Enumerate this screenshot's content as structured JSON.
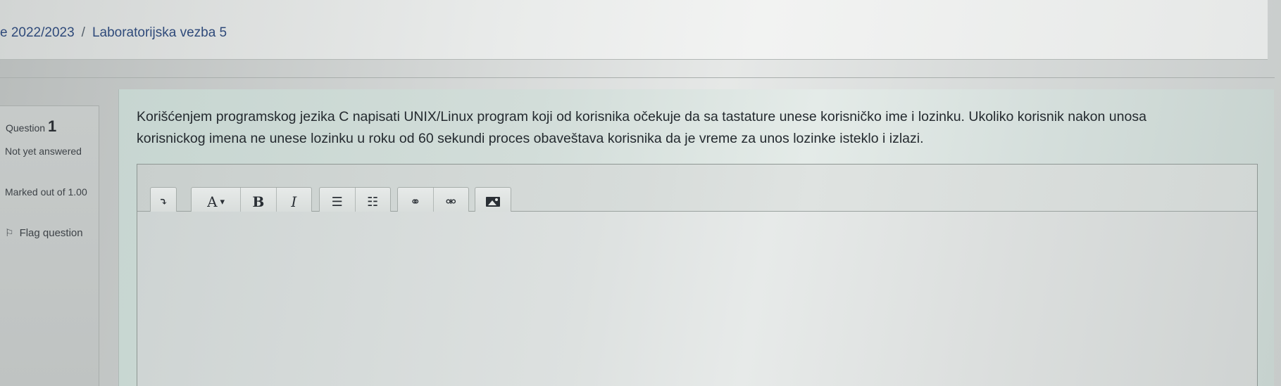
{
  "breadcrumb": {
    "items": [
      "e 2022/2023",
      "Laboratorijska vezba 5"
    ],
    "separator": "/"
  },
  "question_info": {
    "label": "Question",
    "number": "1",
    "state": "Not yet answered",
    "grade": "Marked out of 1.00",
    "flag_label": "Flag question"
  },
  "question": {
    "text": "Korišćenjem programskog jezika C napisati UNIX/Linux program koji od korisnika očekuje da sa tastature unese korisničko ime i lozinku. Ukoliko korisnik nakon unosa korisnickog imena ne unese lozinku u roku od 60 sekundi proces obaveštava korisnika da je vreme za unos lozinke isteklo i izlazi."
  },
  "editor": {
    "toolbar": {
      "collapse": "⤵",
      "para_style": "A",
      "para_caret": "▾",
      "bold": "B",
      "italic": "I",
      "unordered_list": "☰",
      "ordered_list": "☷",
      "link": "⚭",
      "unlink": "⚮",
      "image": "▲"
    },
    "value": ""
  },
  "colors": {
    "link": "#2f4a7a",
    "text": "#242a2f",
    "panel": "#d2ddd9"
  }
}
